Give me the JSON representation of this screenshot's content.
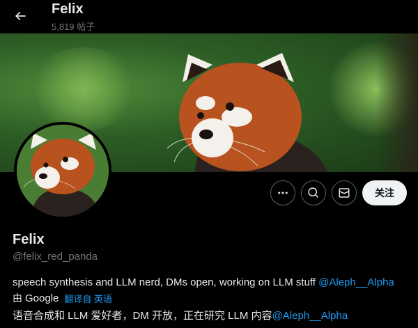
{
  "header": {
    "name": "Felix",
    "posts": "5,819 帖子"
  },
  "profile": {
    "display_name": "Felix",
    "handle": "@felix_red_panda",
    "bio_text": "speech synthesis and LLM nerd, DMs open, working on LLM stuff ",
    "bio_mention": "@Aleph__Alpha",
    "translated_by": "由",
    "translator": "Google",
    "translate_link": "翻译自 英语",
    "translated_text": "语音合成和 LLM 爱好者，DM 开放，正在研究 LLM 内容",
    "translated_mention": "@Aleph__Alpha"
  },
  "actions": {
    "follow_label": "关注"
  },
  "colors": {
    "accent": "#1d9bf0",
    "background": "#000000",
    "secondary_text": "#71767b"
  }
}
